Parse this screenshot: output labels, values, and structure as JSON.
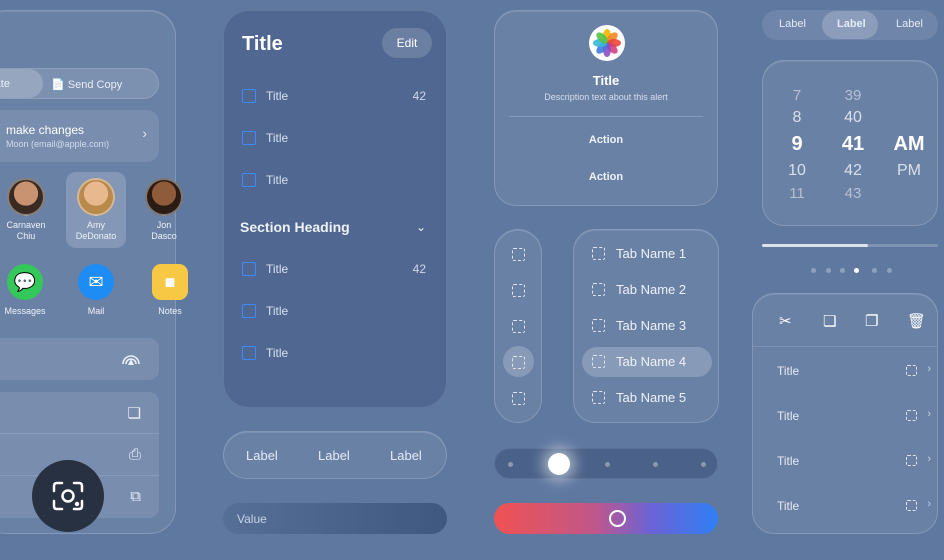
{
  "share_sheet": {
    "segment": {
      "left_label": "rate",
      "right_label": "Send Copy"
    },
    "collaborate": {
      "title": "make changes",
      "subtitle": "Moon (email@apple.com)",
      "chevron": "›"
    },
    "people": [
      {
        "name_line1": "Carnaven",
        "name_line2": "Chiu"
      },
      {
        "name_line1": "Amy",
        "name_line2": "DeDonato"
      },
      {
        "name_line1": "Jon",
        "name_line2": "Dasco"
      }
    ],
    "apps": [
      {
        "name": "Messages",
        "icon": "messages-icon"
      },
      {
        "name": "Mail",
        "icon": "mail-icon"
      },
      {
        "name": "Notes",
        "icon": "notes-icon"
      }
    ]
  },
  "list_card": {
    "title": "Title",
    "edit_label": "Edit",
    "items_top": [
      {
        "label": "Title",
        "count": "42"
      },
      {
        "label": "Title",
        "count": ""
      },
      {
        "label": "Title",
        "count": ""
      }
    ],
    "section_heading": "Section Heading",
    "items_bottom": [
      {
        "label": "Title",
        "count": "42"
      },
      {
        "label": "Title",
        "count": ""
      },
      {
        "label": "Title",
        "count": ""
      }
    ]
  },
  "segment_bottom": {
    "labels": [
      "Label",
      "Label",
      "Label"
    ]
  },
  "value_field": {
    "placeholder": "Value"
  },
  "alert": {
    "title": "Title",
    "description": "Description text about this alert",
    "action1": "Action",
    "action2": "Action"
  },
  "tabs": [
    {
      "label": "Tab Name 1"
    },
    {
      "label": "Tab Name 2"
    },
    {
      "label": "Tab Name 3"
    },
    {
      "label": "Tab Name 4"
    },
    {
      "label": "Tab Name 5"
    }
  ],
  "top_segment": {
    "labels": [
      "Label",
      "Label",
      "Label"
    ]
  },
  "time_picker": {
    "hours": [
      "7",
      "8",
      "9",
      "10",
      "11"
    ],
    "minutes": [
      "39",
      "40",
      "41",
      "42",
      "43"
    ],
    "periods": [
      "AM",
      "PM"
    ]
  },
  "progress": {
    "value": 0.6
  },
  "edit_menu": {
    "rows": [
      {
        "label": "Title"
      },
      {
        "label": "Title"
      },
      {
        "label": "Title"
      },
      {
        "label": "Title"
      }
    ]
  },
  "colors": {
    "accent": "#3d8cff",
    "background": "#5f78a0"
  }
}
